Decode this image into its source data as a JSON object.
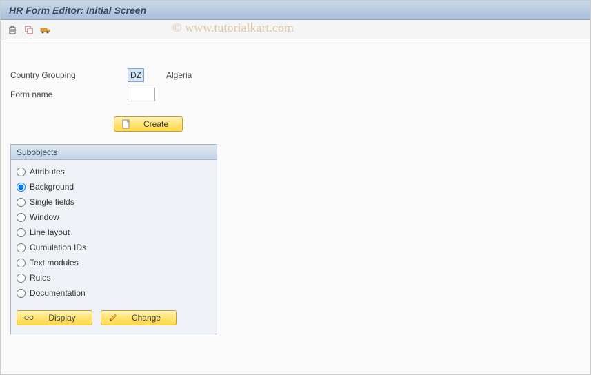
{
  "title": "HR Form Editor: Initial Screen",
  "watermark": "© www.tutorialkart.com",
  "toolbar": {
    "delete_tip": "Delete",
    "copy_tip": "Copy",
    "transport_tip": "Transport"
  },
  "form": {
    "country_label": "Country Grouping",
    "country_value": "DZ",
    "country_name": "Algeria",
    "formname_label": "Form name",
    "formname_value": ""
  },
  "buttons": {
    "create": "Create",
    "display": "Display",
    "change": "Change"
  },
  "subobjects": {
    "title": "Subobjects",
    "items": [
      {
        "label": "Attributes",
        "selected": false
      },
      {
        "label": "Background",
        "selected": true
      },
      {
        "label": "Single fields",
        "selected": false
      },
      {
        "label": "Window",
        "selected": false
      },
      {
        "label": "Line layout",
        "selected": false
      },
      {
        "label": "Cumulation IDs",
        "selected": false
      },
      {
        "label": "Text modules",
        "selected": false
      },
      {
        "label": "Rules",
        "selected": false
      },
      {
        "label": "Documentation",
        "selected": false
      }
    ]
  }
}
